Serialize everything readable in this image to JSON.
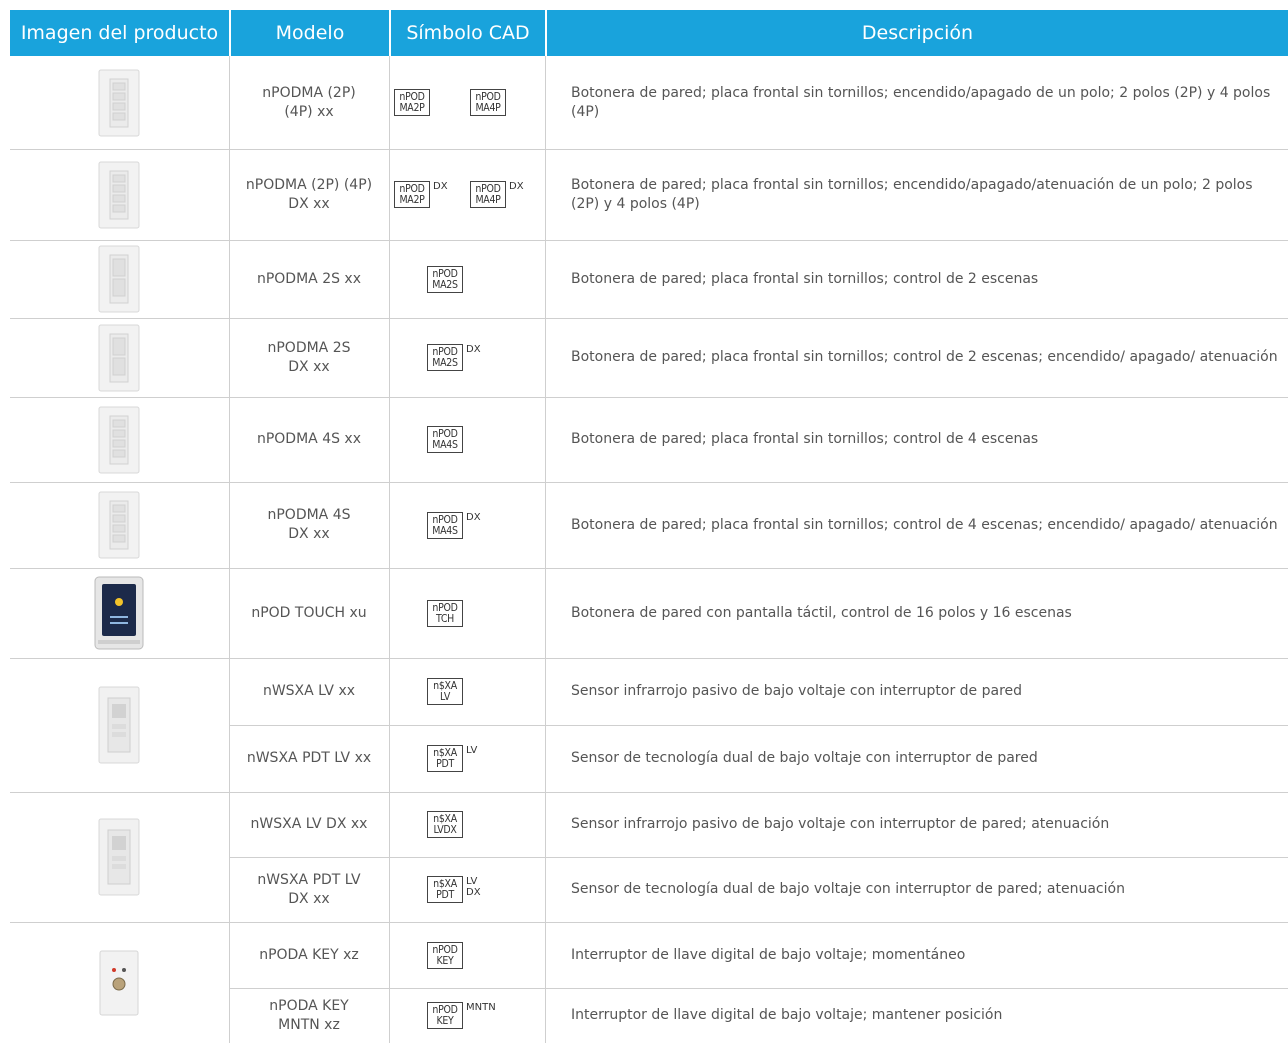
{
  "header": {
    "col_image": "Imagen del producto",
    "col_model": "Modelo",
    "col_cad": "Símbolo CAD",
    "col_desc": "Descripción"
  },
  "rows": [
    {
      "model": [
        "nPODMA (2P)",
        "(4P) xx"
      ],
      "cad": [
        {
          "lines": [
            "nPOD",
            "MA2P"
          ],
          "suffix": ""
        },
        {
          "lines": [
            "nPOD",
            "MA4P"
          ],
          "suffix": ""
        }
      ],
      "desc": "Botonera de pared; placa frontal sin tornillos; encendido/apagado de un polo; 2  polos (2P) y 4 polos (4P)",
      "image": "wall-keypad-4-button"
    },
    {
      "model": [
        "nPODMA (2P) (4P)",
        "DX xx"
      ],
      "cad": [
        {
          "lines": [
            "nPOD",
            "MA2P"
          ],
          "suffix": "DX"
        },
        {
          "lines": [
            "nPOD",
            "MA4P"
          ],
          "suffix": "DX"
        }
      ],
      "desc": "Botonera de pared; placa frontal sin tornillos; encendido/apagado/atenuación de un polo; 2 polos (2P) y 4 polos (4P)",
      "image": "wall-keypad-4-button-dimmer"
    },
    {
      "model": [
        "nPODMA 2S xx"
      ],
      "cad": [
        {
          "lines": [
            "nPOD",
            "MA2S"
          ],
          "suffix": ""
        }
      ],
      "desc": "Botonera de pared; placa frontal sin tornillos; control de 2 escenas",
      "image": "wall-keypad-2-scene"
    },
    {
      "model": [
        "nPODMA 2S",
        "DX xx"
      ],
      "cad": [
        {
          "lines": [
            "nPOD",
            "MA2S"
          ],
          "suffix": "DX"
        }
      ],
      "desc": "Botonera de pared; placa frontal sin tornillos; control de 2 escenas; encendido/  apagado/ atenuación",
      "image": "wall-keypad-2-scene-dimmer"
    },
    {
      "model": [
        "nPODMA 4S xx"
      ],
      "cad": [
        {
          "lines": [
            "nPOD",
            "MA4S"
          ],
          "suffix": ""
        }
      ],
      "desc": "Botonera de pared; placa frontal sin tornillos; control de 4 escenas",
      "image": "wall-keypad-4-scene"
    },
    {
      "model": [
        "nPODMA 4S",
        "DX xx"
      ],
      "cad": [
        {
          "lines": [
            "nPOD",
            "MA4S"
          ],
          "suffix": "DX"
        }
      ],
      "desc": "Botonera de pared; placa frontal sin tornillos; control de 4 escenas; encendido/  apagado/ atenuación",
      "image": "wall-keypad-4-scene-dimmer"
    },
    {
      "model": [
        "nPOD TOUCH xu"
      ],
      "cad": [
        {
          "lines": [
            "nPOD",
            "TCH"
          ],
          "suffix": ""
        }
      ],
      "desc": "Botonera de pared con pantalla táctil, control de 16 polos y 16 escenas",
      "image": "touchscreen-keypad"
    },
    {
      "model": [
        "nWSXA LV xx"
      ],
      "cad": [
        {
          "lines": [
            "n$XA",
            "LV"
          ],
          "suffix": ""
        }
      ],
      "desc": "Sensor infrarrojo pasivo de bajo voltaje con interruptor de pared",
      "image": "wall-switch-sensor"
    },
    {
      "model": [
        "nWSXA PDT LV xx"
      ],
      "cad": [
        {
          "lines": [
            "n$XA",
            "PDT"
          ],
          "suffix": "LV"
        }
      ],
      "desc": "Sensor de tecnología dual de bajo voltaje con interruptor de pared",
      "image": ""
    },
    {
      "model": [
        "nWSXA LV DX xx"
      ],
      "cad": [
        {
          "lines": [
            "n$XA",
            "LVDX"
          ],
          "suffix": ""
        }
      ],
      "desc": "Sensor infrarrojo pasivo de bajo voltaje con interruptor de pared; atenuación",
      "image": "wall-switch-sensor-dimmer"
    },
    {
      "model": [
        "nWSXA PDT LV",
        "DX xx"
      ],
      "cad": [
        {
          "lines": [
            "n$XA",
            "PDT"
          ],
          "suffix": "LV\nDX"
        }
      ],
      "desc": "Sensor de tecnología dual de bajo voltaje con interruptor de pared; atenuación",
      "image": ""
    },
    {
      "model": [
        "nPODA KEY xz"
      ],
      "cad": [
        {
          "lines": [
            "nPOD",
            "KEY"
          ],
          "suffix": ""
        }
      ],
      "desc": "Interruptor de llave digital de bajo voltaje; momentáneo",
      "image": "key-switch"
    },
    {
      "model": [
        "nPODA KEY",
        "MNTN xz"
      ],
      "cad": [
        {
          "lines": [
            "nPOD",
            "KEY"
          ],
          "suffix": "MNTN"
        }
      ],
      "desc": "Interruptor de llave digital de bajo voltaje; mantener posición",
      "image": ""
    }
  ]
}
